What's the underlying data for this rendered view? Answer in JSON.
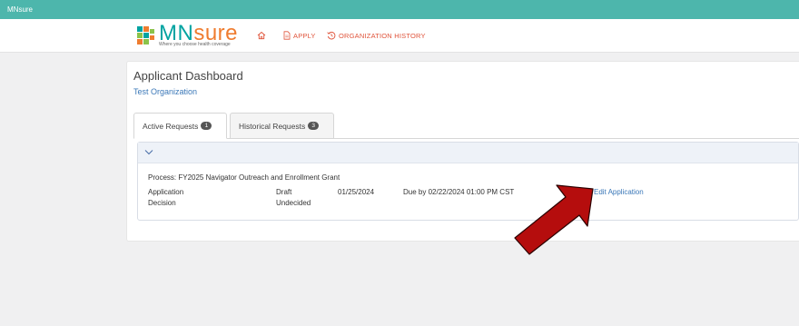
{
  "topbar": {
    "brand": "MNsure"
  },
  "logo": {
    "word_a": "MN",
    "word_b": "sure",
    "tagline": "Where you choose health coverage"
  },
  "nav": {
    "apply": "APPLY",
    "history": "ORGANIZATION HISTORY"
  },
  "dashboard": {
    "title": "Applicant Dashboard",
    "organization": "Test Organization"
  },
  "tabs": [
    {
      "label": "Active Requests",
      "count": "1"
    },
    {
      "label": "Historical Requests",
      "count": "3"
    }
  ],
  "request": {
    "process": "Process: FY2025 Navigator Outreach and Enrollment Grant",
    "rows": [
      {
        "type": "Application",
        "status": "Draft",
        "date": "01/25/2024",
        "due": "Due by 02/22/2024 01:00 PM CST"
      },
      {
        "type": "Decision",
        "status": "Undecided"
      }
    ],
    "action": "Edit Application"
  },
  "colors": {
    "teal": "#4db6ac",
    "nav_accent": "#e0533a",
    "link": "#3b78b8",
    "arrow": "#b50d0d"
  }
}
